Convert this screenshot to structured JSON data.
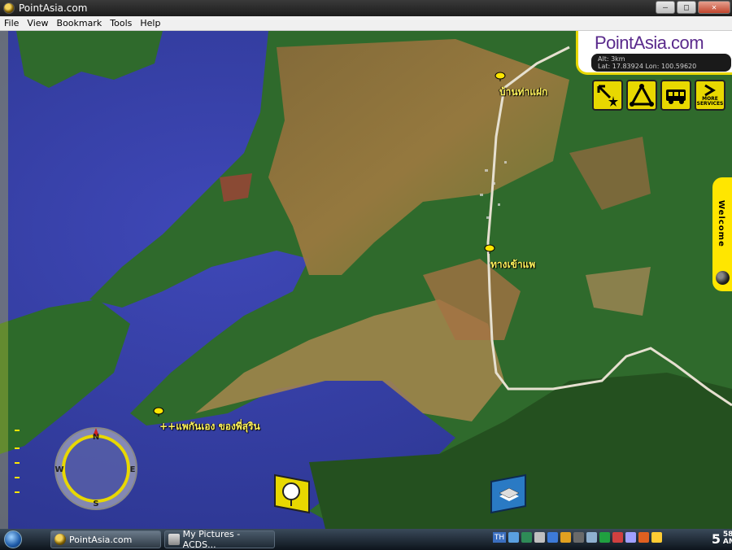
{
  "window": {
    "title": "PointAsia.com",
    "minimize": "–",
    "maximize": "□",
    "close": "✕"
  },
  "menu": [
    "File",
    "View",
    "Bookmark",
    "Tools",
    "Help"
  ],
  "brand": {
    "name": "PointAsia.com",
    "alt": "Alt: 3km",
    "coords": "Lat: 17.83924 Lon: 100.59620"
  },
  "services": {
    "more_line1": "MORE",
    "more_line2": "SERVICES"
  },
  "welcome": "Welcome",
  "places": [
    {
      "label": "บ้านท่าแฝก"
    },
    {
      "label": "ทางเข้าแพ"
    },
    {
      "label": "++แพกันเอง ของพี่สุริน"
    }
  ],
  "compass": {
    "n": "N",
    "s": "S",
    "e": "E",
    "w": "W"
  },
  "taskbar": {
    "items": [
      {
        "label": "PointAsia.com"
      },
      {
        "label": "My Pictures - ACDS..."
      }
    ],
    "lang": "TH",
    "clock_hour": "5",
    "clock_min": "58",
    "clock_ampm": "AM"
  },
  "colors": {
    "accent": "#e8d800",
    "brand": "#5a2a8c",
    "water": "#3a3fa8",
    "forest": "#2d6b2a"
  }
}
